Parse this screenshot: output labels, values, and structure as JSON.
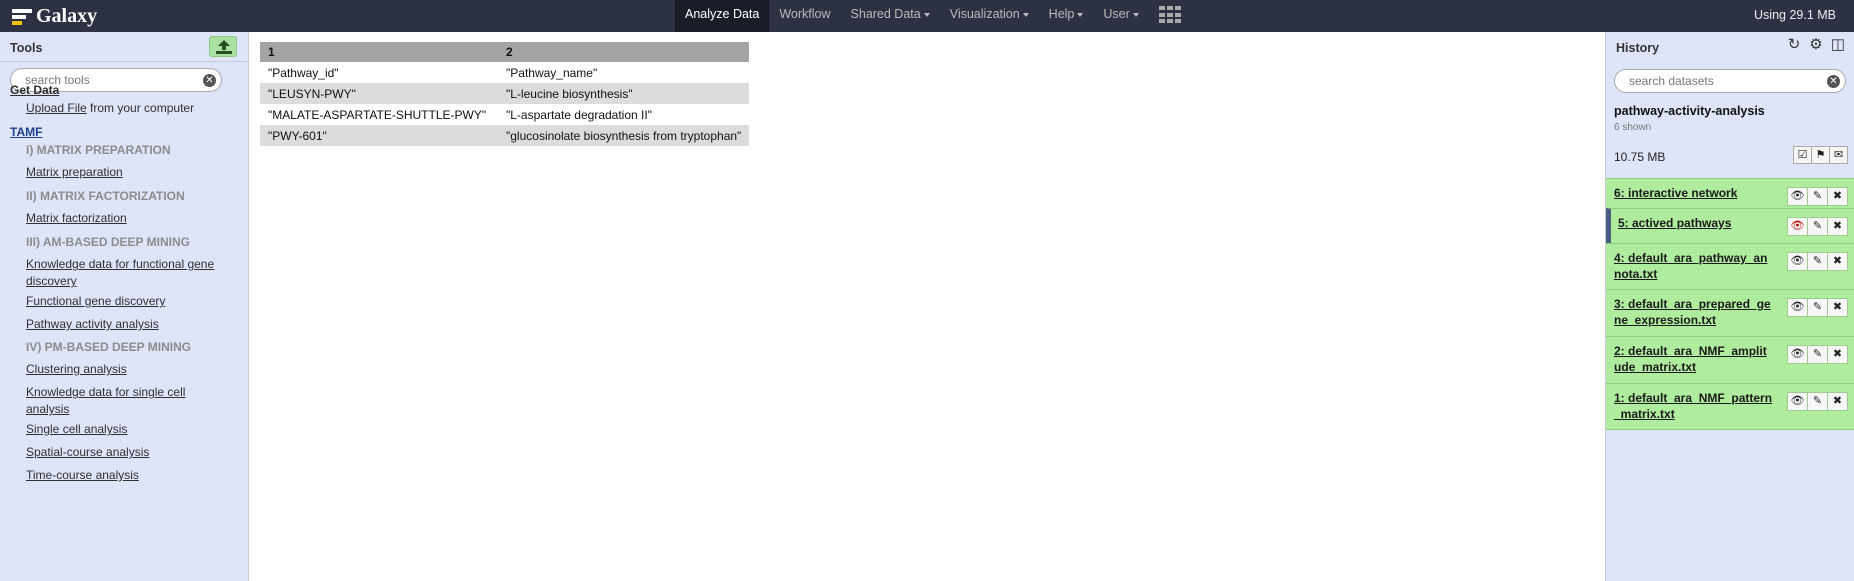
{
  "masthead": {
    "brand": "Galaxy",
    "nav": [
      {
        "label": "Analyze Data",
        "active": true,
        "caret": false
      },
      {
        "label": "Workflow",
        "active": false,
        "caret": false
      },
      {
        "label": "Shared Data",
        "active": false,
        "caret": true
      },
      {
        "label": "Visualization",
        "active": false,
        "caret": true
      },
      {
        "label": "Help",
        "active": false,
        "caret": true
      },
      {
        "label": "User",
        "active": false,
        "caret": true
      }
    ],
    "quota": "Using 29.1 MB"
  },
  "tools": {
    "title": "Tools",
    "search_placeholder": "search tools",
    "get_data": "Get Data",
    "upload_link": "Upload File",
    "upload_rest": " from your computer",
    "section": "TAMF",
    "items": [
      {
        "kind": "section",
        "label": "I) MATRIX PREPARATION"
      },
      {
        "kind": "link",
        "label": "Matrix preparation"
      },
      {
        "kind": "section",
        "label": "II) MATRIX FACTORIZATION"
      },
      {
        "kind": "link",
        "label": "Matrix factorization"
      },
      {
        "kind": "section",
        "label": "III) AM-BASED DEEP MINING"
      },
      {
        "kind": "link",
        "label": "Knowledge data for functional gene discovery"
      },
      {
        "kind": "link",
        "label": "Functional gene discovery"
      },
      {
        "kind": "link",
        "label": "Pathway activity analysis"
      },
      {
        "kind": "section",
        "label": "IV) PM-BASED DEEP MINING"
      },
      {
        "kind": "link",
        "label": "Clustering analysis"
      },
      {
        "kind": "link",
        "label": "Knowledge data for single cell analysis"
      },
      {
        "kind": "link",
        "label": "Single cell analysis"
      },
      {
        "kind": "link",
        "label": "Spatial-course analysis"
      },
      {
        "kind": "link",
        "label": "Time-course analysis"
      }
    ]
  },
  "table": {
    "headers": [
      "1",
      "2"
    ],
    "rows": [
      [
        "\"Pathway_id\"",
        "\"Pathway_name\""
      ],
      [
        "\"LEUSYN-PWY\"",
        "\"L-leucine biosynthesis\""
      ],
      [
        "\"MALATE-ASPARTATE-SHUTTLE-PWY\"",
        "\"L-aspartate degradation II\""
      ],
      [
        "\"PWY-601\"",
        "\"glucosinolate biosynthesis from tryptophan\""
      ]
    ]
  },
  "history": {
    "title": "History",
    "search_placeholder": "search datasets",
    "name": "pathway-activity-analysis",
    "shown": "6 shown",
    "size": "10.75 MB",
    "datasets": [
      {
        "title": "6: interactive network",
        "current": false,
        "eye_color": "#222222"
      },
      {
        "title": "5: actived pathways",
        "current": true,
        "eye_color": "#c00000"
      },
      {
        "title": "4: default_ara_pathway_annota.txt",
        "current": false,
        "eye_color": "#222222"
      },
      {
        "title": "3: default_ara_prepared_gene_expression.txt",
        "current": false,
        "eye_color": "#222222"
      },
      {
        "title": "2: default_ara_NMF_amplitude_matrix.txt",
        "current": false,
        "eye_color": "#222222"
      },
      {
        "title": "1: default_ara_NMF_pattern_matrix.txt",
        "current": false,
        "eye_color": "#222222"
      }
    ]
  }
}
